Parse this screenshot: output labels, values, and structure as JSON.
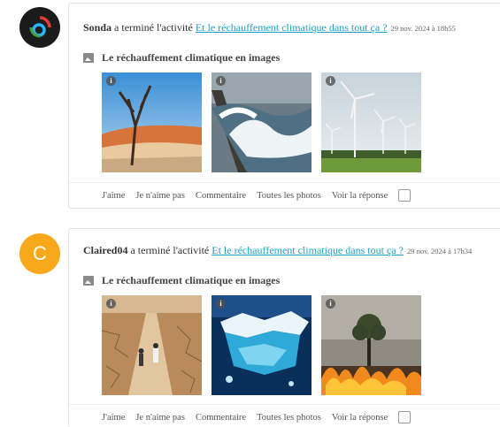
{
  "feed": [
    {
      "user": "Sonda",
      "action_text": " a terminé l'activité ",
      "activity_link": "Et le réchauffement climatique dans tout ça ?",
      "date": "29 nov. 2024 à 18h55",
      "album_title": "Le réchauffement climatique en images",
      "avatar_letter": "",
      "photos": [
        {
          "icon": "info-icon",
          "subject": "dead-tree-desert"
        },
        {
          "icon": "info-icon",
          "subject": "waves-on-pier"
        },
        {
          "icon": "info-icon",
          "subject": "wind-turbines"
        }
      ]
    },
    {
      "user": "Claired04",
      "action_text": " a terminé l'activité ",
      "activity_link": "Et le réchauffement climatique dans tout ça ?",
      "date": "29 nov. 2024 à 17h34",
      "album_title": "Le réchauffement climatique en images",
      "avatar_letter": "C",
      "photos": [
        {
          "icon": "info-icon",
          "subject": "drought-road-children"
        },
        {
          "icon": "info-icon",
          "subject": "melting-iceberg"
        },
        {
          "icon": "info-icon",
          "subject": "forest-fire"
        }
      ]
    }
  ],
  "actions": {
    "like": "J'aime",
    "dislike": "Je n'aime pas",
    "comment": "Commentaire",
    "all_photos": "Toutes les photos",
    "see_answer": "Voir la réponse"
  },
  "info_glyph": "i",
  "colors": {
    "link": "#1d9fc6",
    "avatar_orange": "#f7a81b",
    "avatar_dark": "#1b1b1b"
  }
}
